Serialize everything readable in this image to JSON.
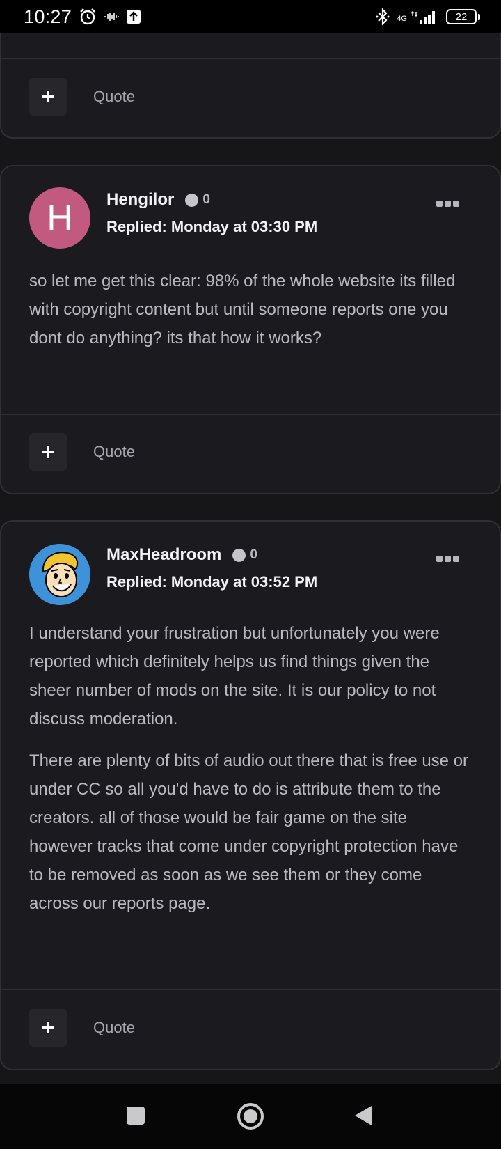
{
  "status_bar": {
    "time": "10:27",
    "network": "4G",
    "battery": "22"
  },
  "posts": [
    {
      "id": "prev",
      "quote_label": "Quote"
    },
    {
      "id": "hengilor",
      "username": "Hengilor",
      "avatar_letter": "H",
      "avatar_color": "#c15a7e",
      "reputation": "0",
      "replied": "Replied: Monday at 03:30 PM",
      "paragraphs": [
        "so let me get this clear: 98% of the whole website its filled with copyright content but until someone reports one you dont do anything? its that how it works?"
      ],
      "quote_label": "Quote"
    },
    {
      "id": "maxheadroom",
      "username": "MaxHeadroom",
      "avatar_icon": "vault-boy-avatar",
      "reputation": "0",
      "replied": "Replied: Monday at 03:52 PM",
      "paragraphs": [
        "I understand your frustration but unfortunately you were reported which definitely helps us find things given the sheer number of mods on the site. It is our policy to not discuss moderation.",
        "There are plenty of bits of audio out there that is free use or under CC so all you'd have to do is attribute them to the creators. all of those would be fair game on the site however tracks that come under copyright protection have to be removed as soon as we see them or they come across our reports page."
      ],
      "quote_label": "Quote"
    }
  ],
  "colors": {
    "background": "#161619",
    "card": "#1b1b1f",
    "border": "#2f2f36",
    "text_muted": "#b9b9c1"
  }
}
